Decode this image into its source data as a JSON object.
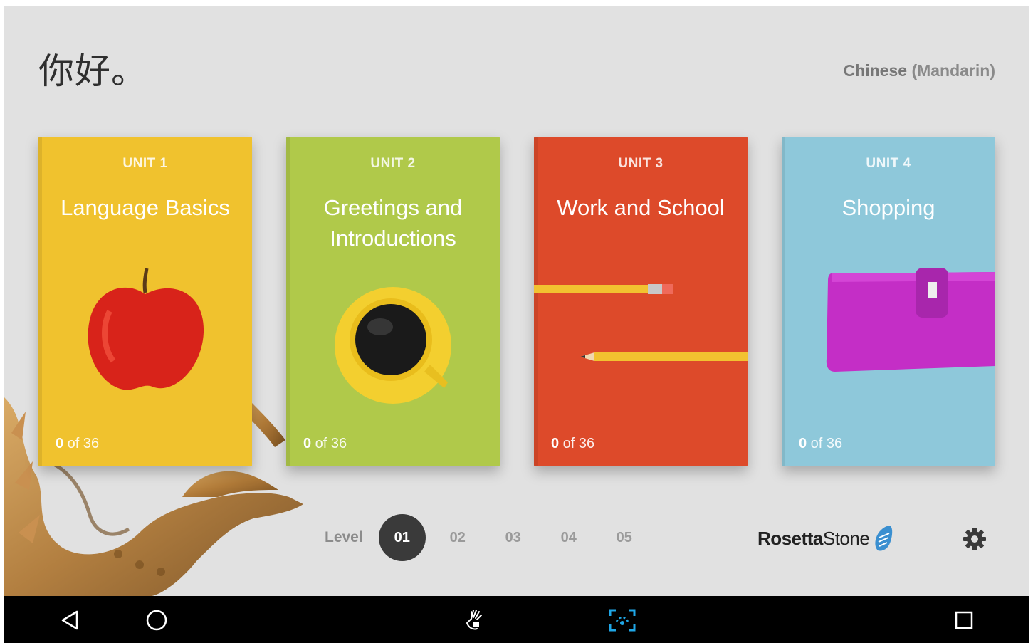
{
  "header": {
    "greeting": "你好。",
    "course_language": "Chinese",
    "course_variant": "(Mandarin)"
  },
  "units": [
    {
      "number_label": "UNIT 1",
      "title": "Language Basics",
      "progress_done": "0",
      "progress_rest": " of 36",
      "color": "#f0c22e",
      "image": "apple-image"
    },
    {
      "number_label": "UNIT 2",
      "title": "Greetings and Introductions",
      "progress_done": "0",
      "progress_rest": " of 36",
      "color": "#b0c94a",
      "image": "coffee-cup-image"
    },
    {
      "number_label": "UNIT 3",
      "title": "Work and School",
      "progress_done": "0",
      "progress_rest": " of 36",
      "color": "#dd4a2a",
      "image": "pencils-image"
    },
    {
      "number_label": "UNIT 4",
      "title": "Shopping",
      "progress_done": "0",
      "progress_rest": " of 36",
      "color": "#8ec8da",
      "image": "wallet-image"
    }
  ],
  "levels": {
    "label": "Level",
    "items": [
      "01",
      "02",
      "03",
      "04",
      "05"
    ],
    "selected": "01"
  },
  "brand": {
    "name_bold": "Rosetta",
    "name_regular": "Stone"
  },
  "icons": {
    "settings": "gear-icon",
    "nav_back": "triangle-back-icon",
    "nav_home": "circle-home-icon",
    "nav_gesture": "hand-gesture-icon",
    "nav_screenshot": "screen-capture-icon",
    "nav_recents": "square-recents-icon"
  }
}
